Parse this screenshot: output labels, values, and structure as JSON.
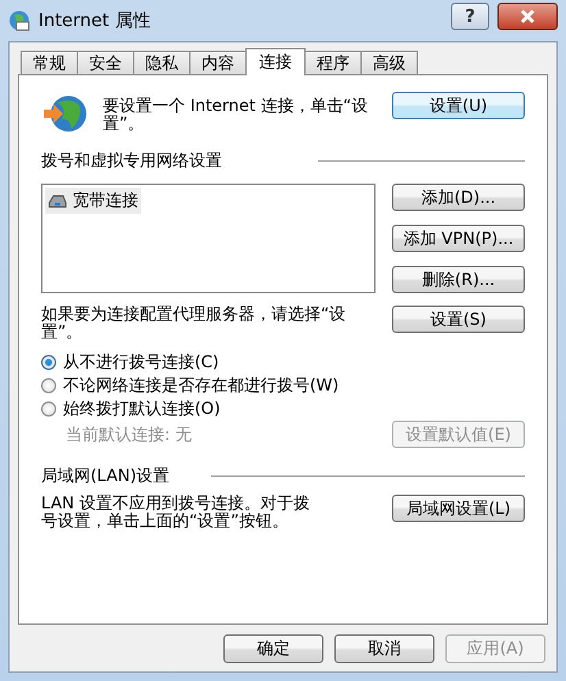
{
  "window": {
    "title": "Internet 属性",
    "help_button": "?"
  },
  "tabs": [
    {
      "label": "常规",
      "selected": false
    },
    {
      "label": "安全",
      "selected": false
    },
    {
      "label": "隐私",
      "selected": false
    },
    {
      "label": "内容",
      "selected": false
    },
    {
      "label": "连接",
      "selected": true
    },
    {
      "label": "程序",
      "selected": false
    },
    {
      "label": "高级",
      "selected": false
    }
  ],
  "setup": {
    "text": "要设置一个 Internet 连接，单击“设置”。",
    "button": {
      "label": "设置(U)",
      "disabled": false
    }
  },
  "dialup": {
    "heading": "拨号和虚拟专用网络设置",
    "connections": [
      {
        "name": "宽带连接",
        "selected": true
      }
    ],
    "buttons": [
      {
        "label": "添加(D)...",
        "disabled": false
      },
      {
        "label": "添加 VPN(P)...",
        "disabled": false
      },
      {
        "label": "删除(R)...",
        "disabled": false
      }
    ]
  },
  "proxy": {
    "text": "如果要为连接配置代理服务器，请选择“设置”。",
    "button": {
      "label": "设置(S)",
      "disabled": false
    }
  },
  "dial_options": [
    {
      "label": "从不进行拨号连接(C)",
      "selected": true
    },
    {
      "label": "不论网络连接是否存在都进行拨号(W)",
      "selected": false
    },
    {
      "label": "始终拨打默认连接(O)",
      "selected": false
    }
  ],
  "current_default": {
    "text": "当前默认连接: 无",
    "disabled": true
  },
  "set_default_button": {
    "label": "设置默认值(E)",
    "disabled": true
  },
  "lan": {
    "heading": "局域网(LAN)设置",
    "text": "LAN 设置不应用到拨号连接。对于拨号设置，单击上面的“设置”按钮。",
    "button": {
      "label": "局域网设置(L)",
      "disabled": false
    }
  },
  "footer_buttons": [
    {
      "label": "确定",
      "disabled": false
    },
    {
      "label": "取消",
      "disabled": false
    },
    {
      "label": "应用(A)",
      "disabled": true
    }
  ]
}
